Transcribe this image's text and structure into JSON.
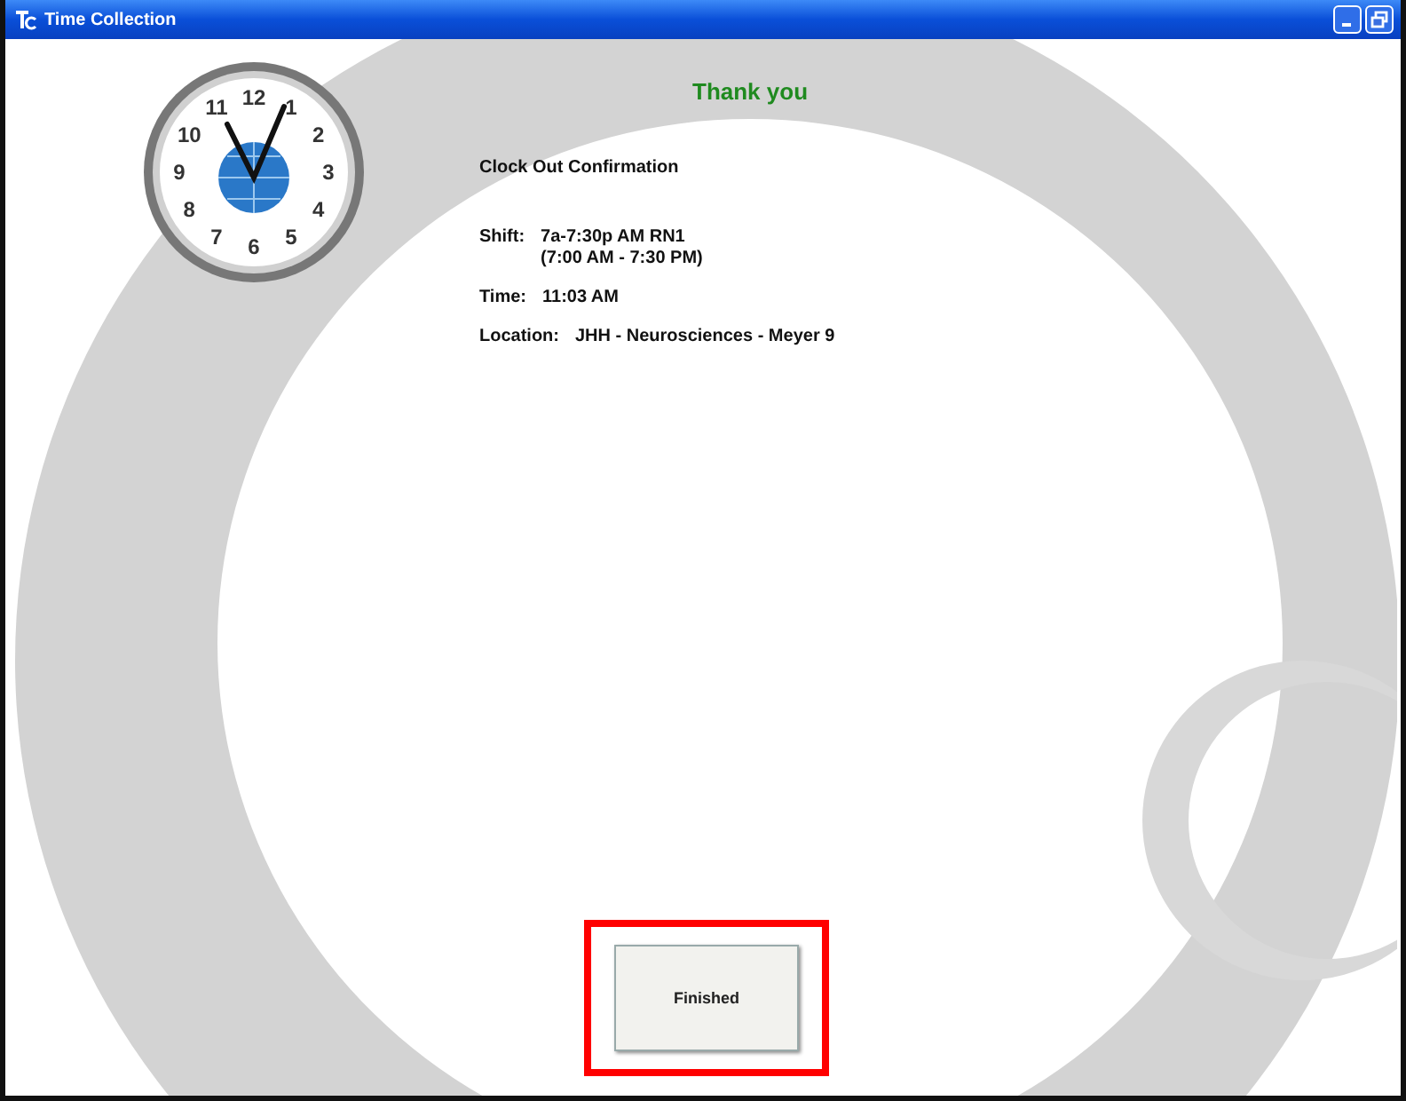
{
  "window": {
    "title": "Time Collection"
  },
  "clock": {
    "numerals": [
      "12",
      "11",
      "1",
      "10",
      "2",
      "9",
      "3",
      "8",
      "4",
      "7",
      "5",
      "6"
    ]
  },
  "heading": "Thank you",
  "confirmation": {
    "title": "Clock Out Confirmation",
    "fields": [
      {
        "label": "Shift:",
        "lines": [
          "7a-7:30p AM RN1",
          "(7:00 AM - 7:30 PM)"
        ]
      },
      {
        "label": "Time:",
        "lines": [
          "11:03 AM"
        ]
      },
      {
        "label": "Location:",
        "lines": [
          "JHH - Neurosciences - Meyer 9"
        ]
      }
    ]
  },
  "finish_button": {
    "label": "Finished",
    "highlighted": true
  }
}
